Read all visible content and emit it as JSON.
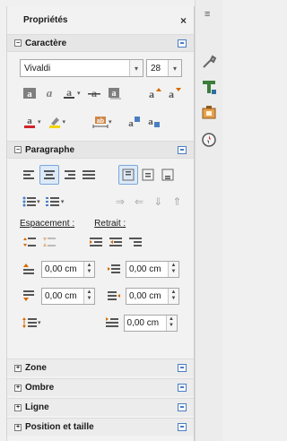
{
  "sidebar": {
    "title": "Propriétés",
    "close_glyph": "×",
    "sections": {
      "character": {
        "label": "Caractère",
        "expander": "−"
      },
      "paragraph": {
        "label": "Paragraphe",
        "expander": "−"
      },
      "area": {
        "label": "Zone",
        "expander": "+"
      },
      "shadow": {
        "label": "Ombre",
        "expander": "+"
      },
      "line": {
        "label": "Ligne",
        "expander": "+"
      },
      "position": {
        "label": "Position et taille",
        "expander": "+"
      }
    }
  },
  "character": {
    "font_name": "Vivaldi",
    "font_size": "28",
    "buttons": [
      "bold-icon",
      "italic-icon",
      "underline-icon",
      "strikethrough-icon",
      "shadow-icon",
      "increase-font-size-icon",
      "decrease-font-size-icon",
      "font-color-icon",
      "highlight-color-icon",
      "character-spacing-icon",
      "superscript-icon",
      "subscript-icon"
    ]
  },
  "paragraph": {
    "spacing_label": "Espacement :",
    "indent_label": "Retrait :",
    "above_spacing": "0,00 cm",
    "below_spacing": "0,00 cm",
    "before_indent": "0,00 cm",
    "after_indent": "0,00 cm",
    "first_line_indent": "0,00 cm"
  },
  "deck": {
    "menu_icon": "menu-icon",
    "tabs": [
      "properties-icon",
      "styles-icon",
      "gallery-icon",
      "navigator-icon"
    ]
  },
  "colors": {
    "accent": "#4a7ec2",
    "font_color": "#d0242a",
    "highlight_color": "#f3d400"
  }
}
